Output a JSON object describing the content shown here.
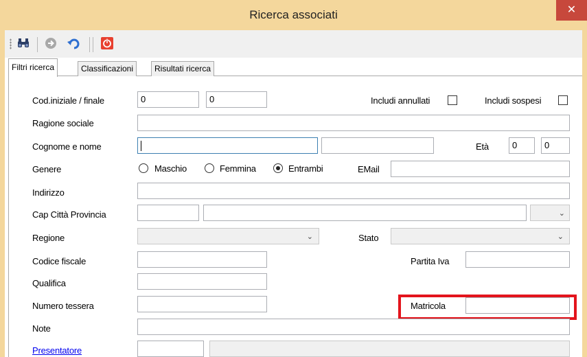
{
  "window": {
    "title": "Ricerca associati",
    "close_glyph": "✕"
  },
  "toolbar": {
    "buttons": [
      {
        "icon": "binoculars-icon",
        "glyph": "🔭"
      },
      {
        "icon": "next-arrow-icon",
        "glyph": "➜"
      },
      {
        "icon": "undo-icon",
        "glyph": "↶"
      },
      {
        "icon": "power-icon",
        "glyph": "⏻"
      }
    ]
  },
  "tabs": [
    "Filtri ricerca",
    "Classificazioni",
    "Risultati ricerca"
  ],
  "form": {
    "cod_label": "Cod.iniziale / finale",
    "cod_start": "0",
    "cod_end": "0",
    "includi_annullati": "Includi annullati",
    "includi_sospesi": "Includi sospesi",
    "ragione_sociale": "Ragione sociale",
    "cognome_nome": "Cognome e nome",
    "eta": "Età",
    "eta_from": "0",
    "eta_to": "0",
    "genere": "Genere",
    "genere_options": [
      "Maschio",
      "Femmina",
      "Entrambi"
    ],
    "genere_selected": "Entrambi",
    "email": "EMail",
    "indirizzo": "Indirizzo",
    "cap_citta": "Cap Città Provincia",
    "regione": "Regione",
    "stato": "Stato",
    "codice_fiscale": "Codice fiscale",
    "partita_iva": "Partita Iva",
    "qualifica": "Qualifica",
    "numero_tessera": "Numero tessera",
    "matricola": "Matricola",
    "note": "Note",
    "presentatore": "Presentatore"
  },
  "combo_arrow": "⌄",
  "colors": {
    "title_bar": "#f4d79c",
    "close": "#c7483c",
    "highlight": "#e3141c",
    "link": "#0000ee"
  }
}
